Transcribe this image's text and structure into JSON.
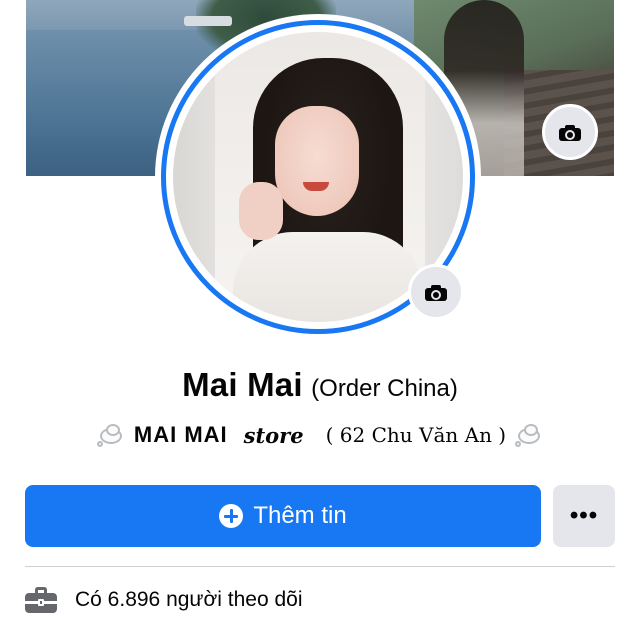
{
  "profile": {
    "name": "Mai Mai",
    "alternate_name": "(Order China)",
    "bio": {
      "bold": "MAI MAI",
      "italic": "store",
      "address": "( 62 Chu Văn An )"
    }
  },
  "actions": {
    "add_story_label": "Thêm tin",
    "more_label": "•••"
  },
  "details": {
    "followers_text": "Có 6.896 người theo dõi"
  },
  "colors": {
    "accent": "#1877f2",
    "secondary_button": "#e4e6eb",
    "icon_gray": "#65676b",
    "divider": "#ced0d4"
  },
  "icons": {
    "cover_camera": "camera-icon",
    "avatar_camera": "camera-icon",
    "bio_emoji": "thought-balloon-icon",
    "add": "plus-circle-icon",
    "followers": "briefcase-icon"
  }
}
